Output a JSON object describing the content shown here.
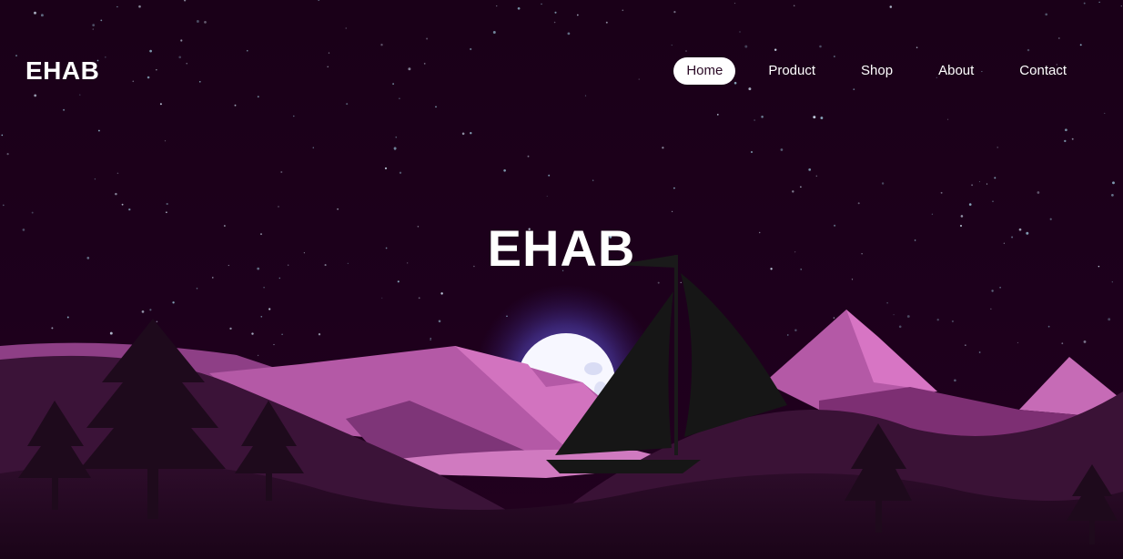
{
  "brand": {
    "logo_text": "EHAB"
  },
  "nav": {
    "items": [
      {
        "label": "Home",
        "active": true
      },
      {
        "label": "Product",
        "active": false
      },
      {
        "label": "Shop",
        "active": false
      },
      {
        "label": "About",
        "active": false
      },
      {
        "label": "Contact",
        "active": false
      }
    ]
  },
  "hero": {
    "title": "EHAB"
  },
  "colors": {
    "night_sky": "#1b0019",
    "mountain_pink": "#c76ab4",
    "mountain_mid": "#9c4a90",
    "hill_dark": "#2a0c28",
    "moon": "#ffffff",
    "moon_glow": "#6a5cf0",
    "sail": "#151515",
    "text": "#ffffff"
  }
}
